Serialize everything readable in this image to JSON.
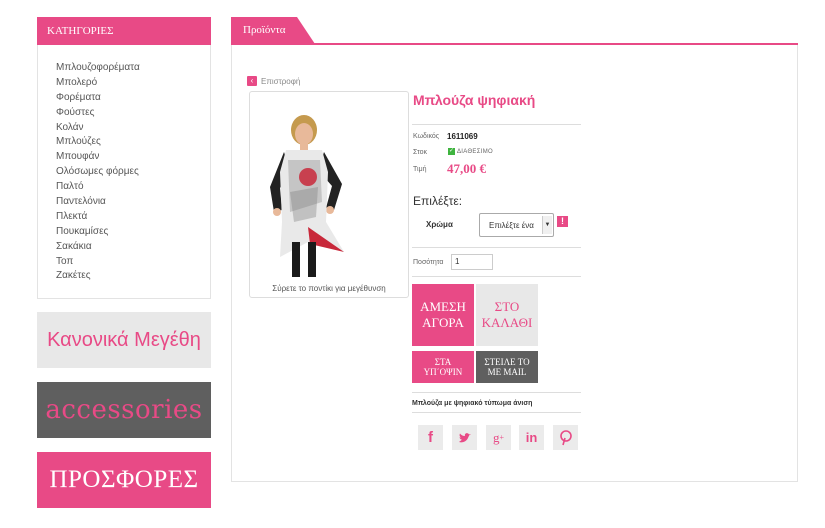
{
  "sidebar": {
    "header": "ΚΑΤΗΓΟΡΙΕΣ",
    "categories": [
      "Μπλουζοφορέματα",
      "Μπολερό",
      "Φορέματα",
      "Φούστες",
      "Κολάν",
      "Μπλούζες",
      "Μπουφάν",
      "Ολόσωμες φόρμες",
      "Παλτό",
      "Παντελόνια",
      "Πλεκτά",
      "Πουκαμίσες",
      "Σακάκια",
      "Τοπ",
      "Ζακέτες"
    ],
    "banners": [
      "Κανονικά Μεγέθη",
      "accessories",
      "ΠΡΟΣΦΟΡΕΣ"
    ]
  },
  "main": {
    "tab": "Προϊόντα",
    "back": "Επιστροφή",
    "image_caption": "Σύρετε το ποντίκι για μεγέθυνση"
  },
  "product": {
    "title": "Μπλούζα ψηφιακή",
    "code_label": "Κωδικός",
    "code": "1611069",
    "stock_label": "Στοκ",
    "stock_status": "ΔΙΑΘΕΣΙΜΟ",
    "price_label": "Τιμή",
    "price": "47,00 €",
    "choose_label": "Επιλέξτε:",
    "color_label": "Χρώμα",
    "color_select": "Επιλέξτε ένα",
    "quantity_label": "Ποσότητα",
    "quantity": "1",
    "buy_now": [
      "ΑΜΕΣΗ",
      "ΑΓΟΡΑ"
    ],
    "add_to_cart": [
      "ΣΤΟ",
      "ΚΑΛΑΘΙ"
    ],
    "wishlist": [
      "ΣΤΑ",
      "ΥΠ΄ΟΨΙΝ"
    ],
    "send_mail": [
      "ΣΤΕΙΛΕ ΤΟ",
      "ΜΕ MAIL"
    ],
    "description": "Μπλούζα με ψηφιακό τύπωμα άνιση"
  },
  "social": [
    "facebook-icon",
    "twitter-icon",
    "google-plus-icon",
    "linkedin-icon",
    "pinterest-icon"
  ],
  "colors": {
    "accent": "#e84a86",
    "gray": "#5f5f5f",
    "light": "#e8e8e8"
  }
}
